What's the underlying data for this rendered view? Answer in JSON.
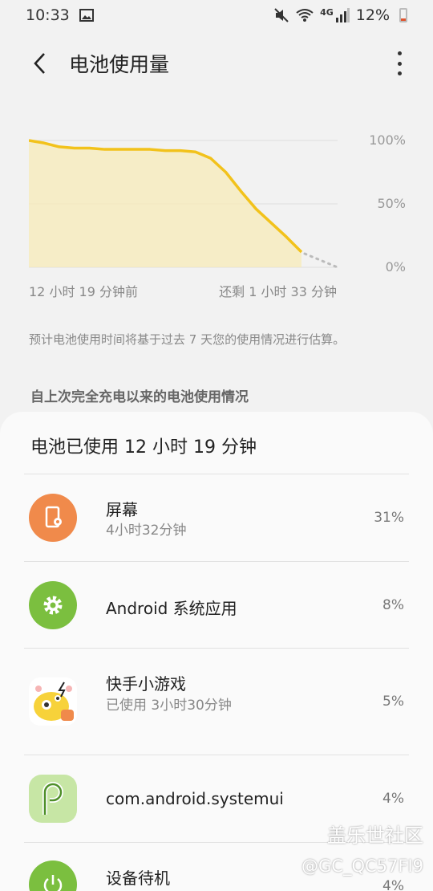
{
  "status": {
    "time": "10:33",
    "network": "4G",
    "battery": "12%",
    "icons": [
      "image-icon",
      "mute-icon",
      "wifi-icon",
      "signal-icon",
      "battery-icon"
    ]
  },
  "header": {
    "title": "电池使用量"
  },
  "chart_data": {
    "type": "area",
    "ylim": [
      0,
      100
    ],
    "yticks": [
      "100%",
      "50%",
      "0%"
    ],
    "xlabel_left": "12 小时 19 分钟前",
    "xlabel_right": "还剩 1 小时 33 分钟",
    "series": [
      {
        "values": [
          100,
          98,
          95,
          94,
          94,
          93,
          93,
          93,
          93,
          92,
          92,
          91,
          86,
          75,
          60,
          46,
          35,
          24,
          12
        ]
      },
      {
        "projection": [
          12,
          0
        ]
      }
    ],
    "colors": {
      "line": "#f2c21b",
      "fill": "#f7ebb8",
      "projection": "#bbbbbb"
    }
  },
  "note": "预计电池使用时间将基于过去 7 天您的使用情况进行估算。",
  "section_label": "自上次完全充电以来的电池使用情况",
  "card": {
    "title": "电池已使用 12 小时 19 分钟",
    "items": [
      {
        "name": "屏幕",
        "sub": "4小时32分钟",
        "pct": "31%",
        "icon": "screen-brightness-icon",
        "color": "#f08a4b"
      },
      {
        "name": "Android 系统应用",
        "sub": "",
        "pct": "8%",
        "icon": "gear-icon",
        "color": "#7bbf3f"
      },
      {
        "name": "快手小游戏",
        "sub": "已使用 3小时30分钟",
        "pct": "5%",
        "icon": "kuaishou-game-icon",
        "color": "#f7d23a"
      },
      {
        "name": "com.android.systemui",
        "sub": "",
        "pct": "4%",
        "icon": "android-p-icon",
        "color": "#c7e6a5"
      },
      {
        "name": "设备待机",
        "sub": "",
        "pct": "4%",
        "icon": "power-icon",
        "color": "#7bbf3f"
      }
    ]
  },
  "watermark": {
    "line1": "盖乐世社区",
    "line2": "@GC_QC57FI9"
  }
}
